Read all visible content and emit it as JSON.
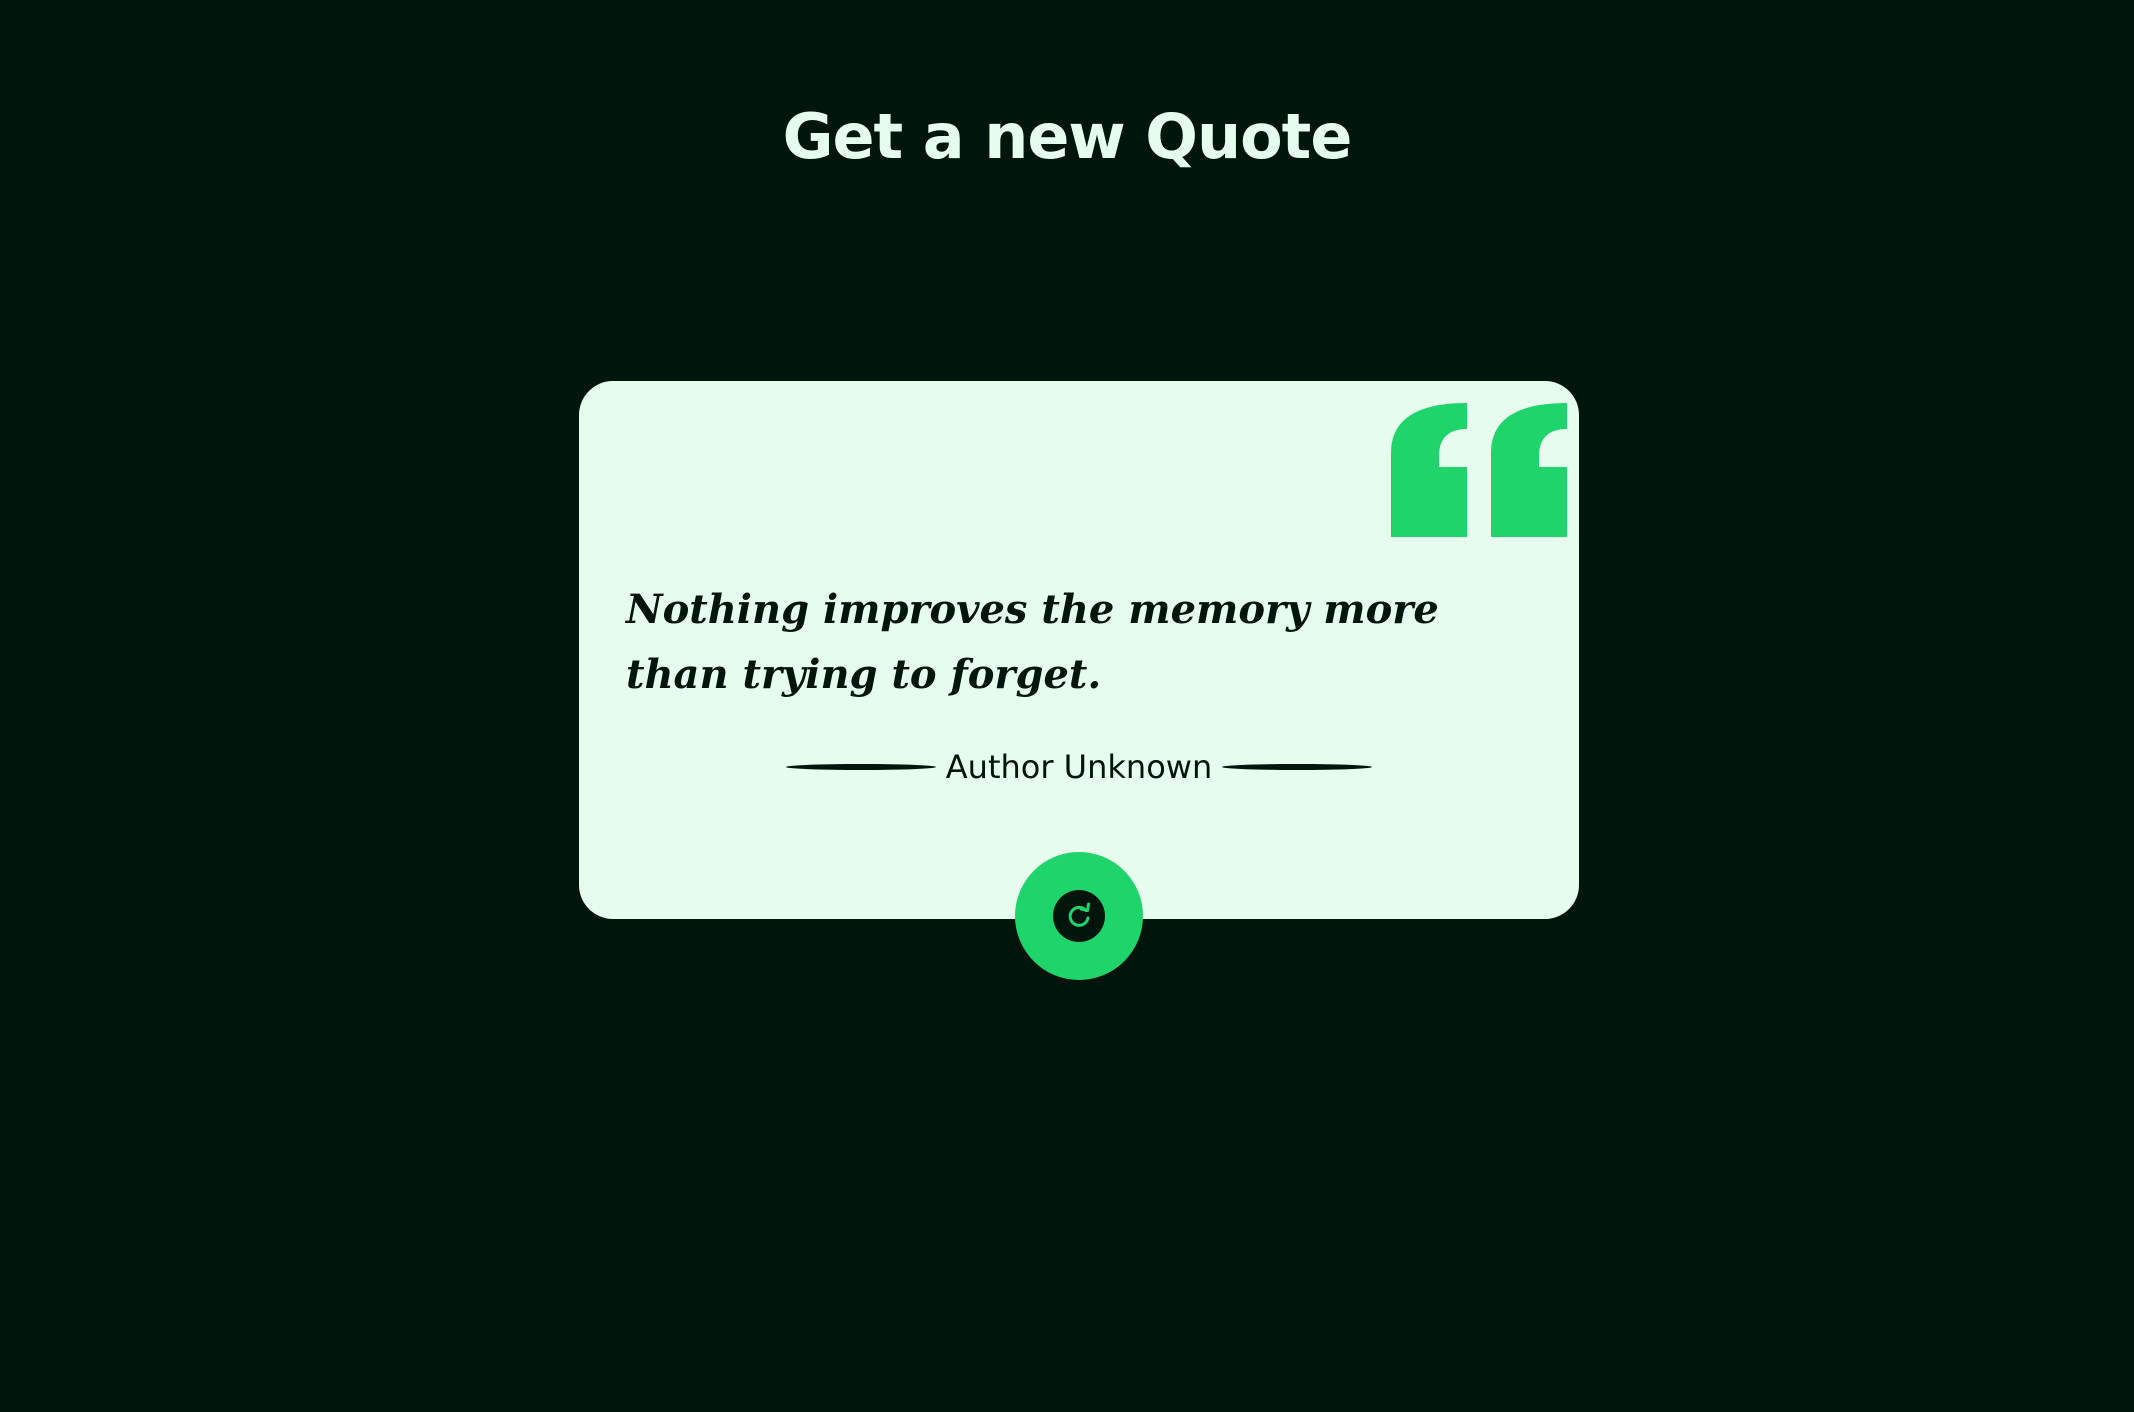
{
  "header": {
    "title": "Get a new Quote"
  },
  "quote": {
    "text": "Nothing improves the memory more than trying to forget.",
    "author": "Author Unknown"
  },
  "icons": {
    "quote_mark": "quote-mark-icon",
    "refresh": "refresh-icon"
  },
  "colors": {
    "background": "#02150d",
    "card": "#e8fbef",
    "accent": "#1fd46b",
    "text_dark": "#02150d",
    "title": "#e7fcef"
  }
}
